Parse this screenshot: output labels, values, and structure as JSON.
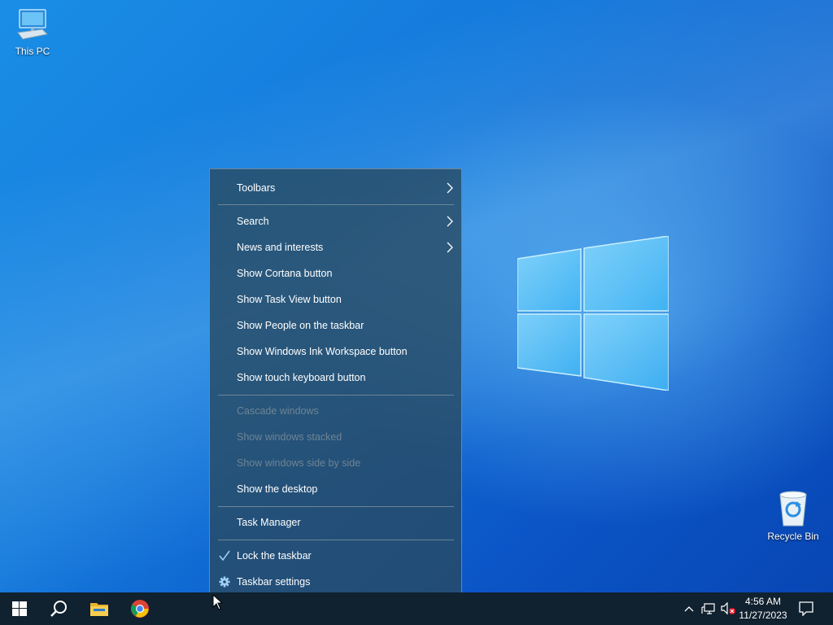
{
  "desktop": {
    "icons": [
      {
        "label": "This PC",
        "icon": "computer-icon"
      },
      {
        "label": "Recycle Bin",
        "icon": "recycle-bin-icon"
      }
    ]
  },
  "context_menu": {
    "items": [
      {
        "label": "Toolbars",
        "submenu": true,
        "enabled": true
      },
      {
        "label": "Search",
        "submenu": true,
        "enabled": true
      },
      {
        "label": "News and interests",
        "submenu": true,
        "enabled": true
      },
      {
        "label": "Show Cortana button",
        "enabled": true
      },
      {
        "label": "Show Task View button",
        "enabled": true
      },
      {
        "label": "Show People on the taskbar",
        "enabled": true
      },
      {
        "label": "Show Windows Ink Workspace button",
        "enabled": true
      },
      {
        "label": "Show touch keyboard button",
        "enabled": true
      },
      {
        "label": "Cascade windows",
        "enabled": false
      },
      {
        "label": "Show windows stacked",
        "enabled": false
      },
      {
        "label": "Show windows side by side",
        "enabled": false
      },
      {
        "label": "Show the desktop",
        "enabled": true
      },
      {
        "label": "Task Manager",
        "enabled": true
      },
      {
        "label": "Lock the taskbar",
        "enabled": true,
        "checked": true,
        "lead_icon": "checkmark-icon"
      },
      {
        "label": "Taskbar settings",
        "enabled": true,
        "lead_icon": "gear-icon"
      }
    ]
  },
  "taskbar": {
    "pinned": [
      "start-icon",
      "search-icon",
      "file-explorer-icon",
      "chrome-icon"
    ],
    "tray": [
      "chevron-up-icon",
      "network-icon",
      "volume-muted-icon"
    ],
    "clock": {
      "time": "4:56 AM",
      "date": "11/27/2023"
    },
    "notifications_icon": "action-center-icon"
  },
  "colors": {
    "taskbar": "#10212f",
    "menu_bg": "#284a62",
    "accent": "#9fd1f7",
    "disabled_text": "#6e8494"
  }
}
